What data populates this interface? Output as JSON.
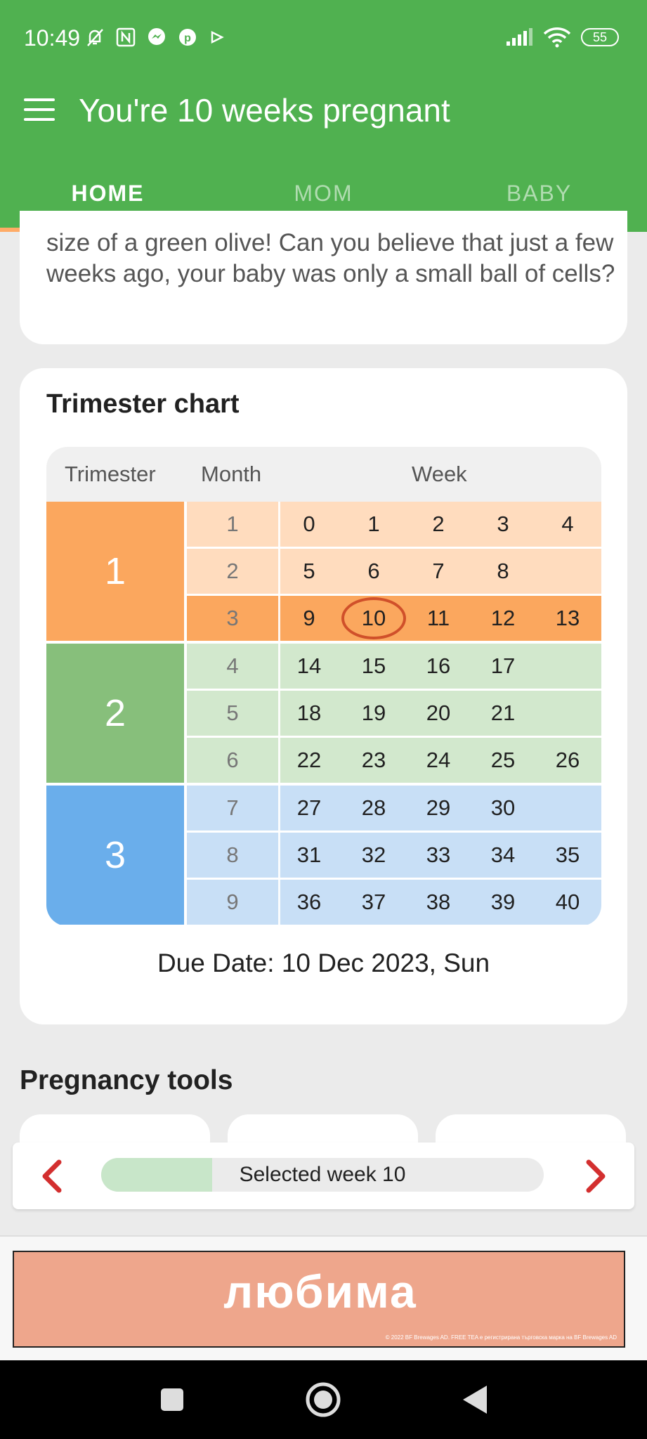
{
  "status_bar": {
    "time": "10:49",
    "battery": "55",
    "left_icons": [
      "bell-off-icon",
      "nfc-icon",
      "messenger-icon",
      "pinterest-icon",
      "play-icon"
    ],
    "right_icons": [
      "signal-icon",
      "wifi-icon",
      "battery-icon"
    ]
  },
  "toolbar": {
    "title": "You're 10 weeks pregnant",
    "menu_icon": "hamburger-menu-icon"
  },
  "tabs": [
    {
      "label": "HOME",
      "active": true
    },
    {
      "label": "MOM",
      "active": false
    },
    {
      "label": "BABY",
      "active": false
    }
  ],
  "intro": {
    "text": "size of a green olive! Can you believe that just a few weeks ago, your baby was only a small ball of cells?"
  },
  "trimester_chart": {
    "title": "Trimester chart",
    "headers": {
      "trimester": "Trimester",
      "month": "Month",
      "week": "Week"
    },
    "trimesters": [
      {
        "label": "1",
        "color": "#fba75e",
        "row_color": "#ffdcbe",
        "highlight_color": "#fba75e",
        "months": [
          {
            "month": "1",
            "weeks": [
              "0",
              "1",
              "2",
              "3",
              "4"
            ]
          },
          {
            "month": "2",
            "weeks": [
              "5",
              "6",
              "7",
              "8"
            ]
          },
          {
            "month": "3",
            "weeks": [
              "9",
              "10",
              "11",
              "12",
              "13"
            ],
            "highlight": true
          }
        ]
      },
      {
        "label": "2",
        "color": "#87bf7b",
        "row_color": "#d2e8cd",
        "months": [
          {
            "month": "4",
            "weeks": [
              "14",
              "15",
              "16",
              "17"
            ]
          },
          {
            "month": "5",
            "weeks": [
              "18",
              "19",
              "20",
              "21"
            ]
          },
          {
            "month": "6",
            "weeks": [
              "22",
              "23",
              "24",
              "25",
              "26"
            ]
          }
        ]
      },
      {
        "label": "3",
        "color": "#6aaeeb",
        "row_color": "#c8dff6",
        "months": [
          {
            "month": "7",
            "weeks": [
              "27",
              "28",
              "29",
              "30"
            ]
          },
          {
            "month": "8",
            "weeks": [
              "31",
              "32",
              "33",
              "34",
              "35"
            ]
          },
          {
            "month": "9",
            "weeks": [
              "36",
              "37",
              "38",
              "39",
              "40"
            ]
          }
        ]
      }
    ],
    "current_week": "10",
    "current_marker_color": "#d0502a",
    "due_date": "Due Date: 10 Dec 2023, Sun"
  },
  "tools": {
    "title": "Pregnancy tools"
  },
  "week_selector": {
    "label": "Selected week 10",
    "progress": 0.25,
    "accent": "#d32f2f",
    "prev_icon": "chevron-left-icon",
    "next_icon": "chevron-right-icon"
  },
  "ad": {
    "text": "любима",
    "fine_print": "© 2022 BF Brewages AD. FREE TEA е регистрирана търговска марка на BF Brewages AD"
  },
  "nav": {
    "icons": [
      "recents-square-icon",
      "home-circle-icon",
      "back-triangle-icon"
    ]
  }
}
